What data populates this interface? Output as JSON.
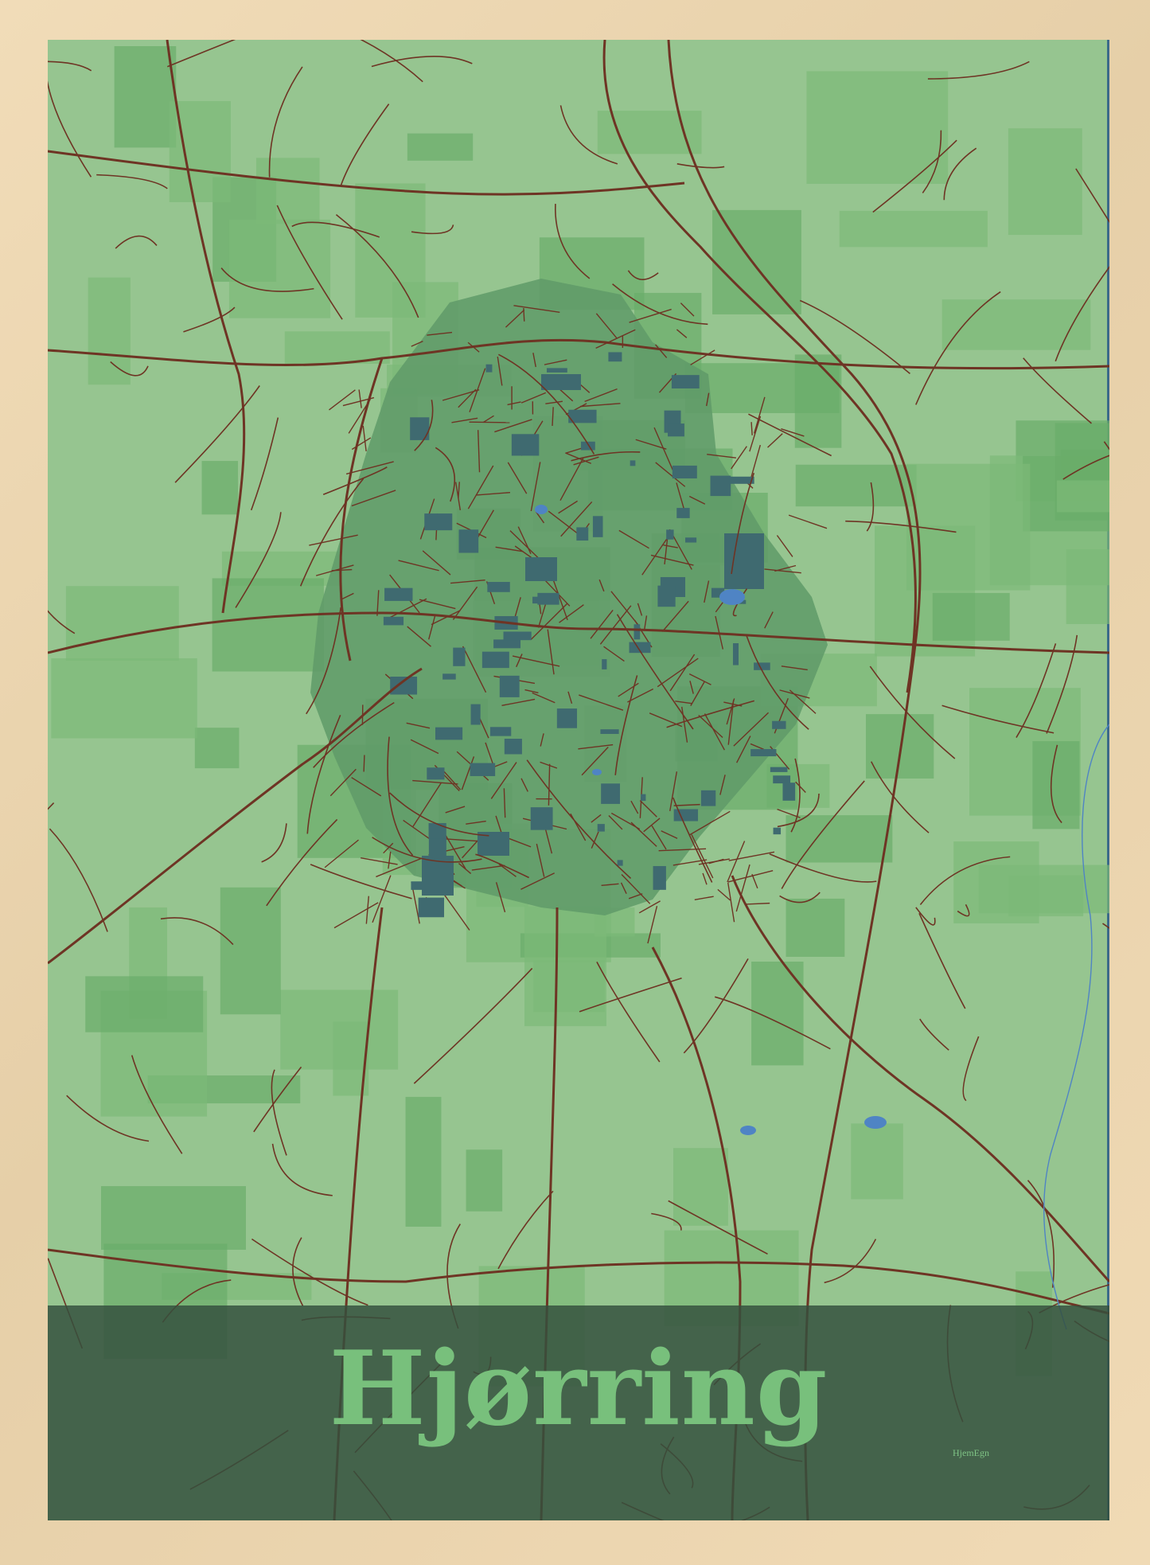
{
  "map": {
    "title": "Hjørring",
    "brand": "HjemEgn"
  },
  "colors": {
    "frame": "#e8d2ae",
    "land": "#96c590",
    "fields": "#7cb978",
    "forest": "#6aad6a",
    "urban": "#4f8a60",
    "buildings": "#3f6a70",
    "roads": "#6e3424",
    "water": "#4f84c4",
    "banner": "#34503e",
    "title_text": "#78c07c"
  }
}
